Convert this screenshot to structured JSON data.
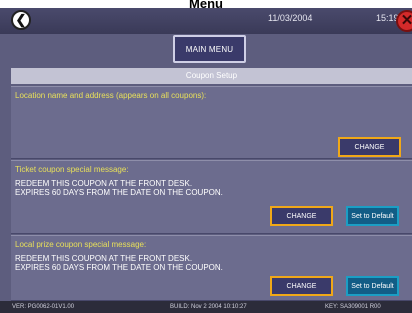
{
  "caption": "Menu",
  "topbar": {
    "date": "11/03/2004",
    "time": "15:19"
  },
  "main_menu_label": "MAIN MENU",
  "section_title": "Coupon Setup",
  "panels": [
    {
      "title": "Location name and address (appears on all coupons):",
      "message_lines": [
        "",
        ""
      ],
      "change_label": "CHANGE"
    },
    {
      "title": "Ticket coupon special message:",
      "message_lines": [
        "REDEEM THIS COUPON AT THE FRONT DESK.",
        "EXPIRES 60 DAYS FROM THE DATE ON THE COUPON."
      ],
      "change_label": "CHANGE",
      "default_label": "Set to Default"
    },
    {
      "title": "Local prize coupon special message:",
      "message_lines": [
        "REDEEM THIS COUPON AT THE FRONT DESK.",
        "EXPIRES 60 DAYS FROM THE DATE ON THE COUPON."
      ],
      "change_label": "CHANGE",
      "default_label": "Set to Default"
    }
  ],
  "footer": {
    "version": "VER: PG0062-01V1.00",
    "build": "BUILD: Nov 2 2004 10:10:27",
    "key": "KEY: SA309001 R00"
  },
  "colors": {
    "screen_bg": "#5d5d7e",
    "title_yellow": "#e8e05a",
    "change_border": "#f0a818",
    "default_bg": "#125d86",
    "close_red": "#d42a2a"
  }
}
